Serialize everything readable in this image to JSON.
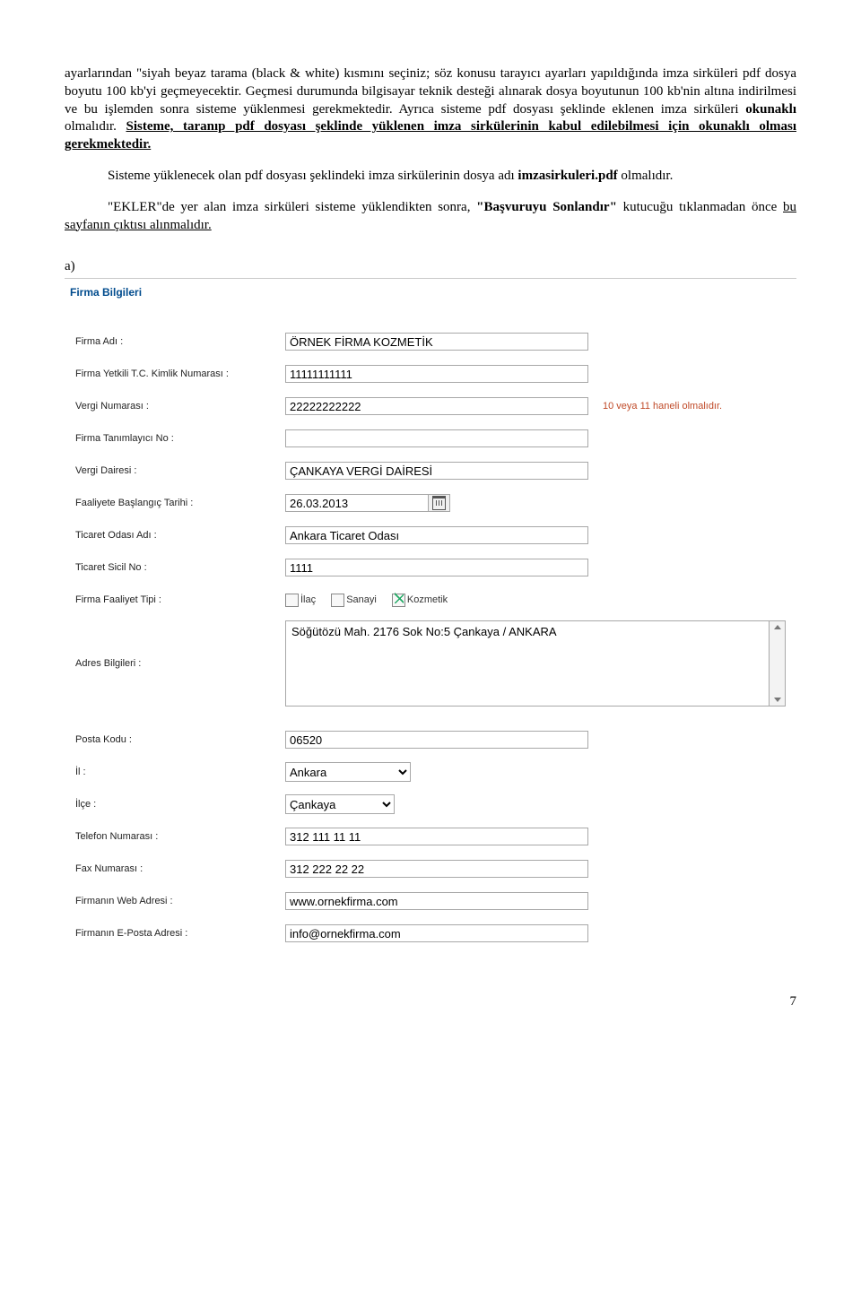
{
  "text": {
    "p1a": "ayarlarından \"siyah beyaz tarama (black & white) kısmını seçiniz; söz konusu tarayıcı ayarları yapıldığında imza sirküleri pdf dosya boyutu 100 kb'yi geçmeyecektir. Geçmesi durumunda bilgisayar teknik desteği alınarak dosya boyutunun 100 kb'nin altına indirilmesi ve bu işlemden sonra sisteme yüklenmesi gerekmektedir. Ayrıca sisteme pdf dosyası şeklinde eklenen imza sirküleri ",
    "p1_bold1": "okunaklı",
    "p1b": " olmalıdır. ",
    "p1_u": "Sisteme, taranıp pdf dosyası şeklinde yüklenen imza sirkülerinin kabul edilebilmesi için okunaklı olması gerekmektedir.",
    "p2a": "Sisteme yüklenecek olan pdf dosyası şeklindeki imza sirkülerinin dosya adı ",
    "p2_bold": "imzasirkuleri.pdf",
    "p2b": " olmalıdır.",
    "p3a": "\"EKLER\"de yer alan imza sirküleri sisteme yüklendikten sonra, ",
    "p3_bold": "\"Başvuruyu Sonlandır\"",
    "p3b": " kutucuğu tıklanmadan önce ",
    "p3_u": "bu sayfanın çıktısı alınmalıdır.",
    "a_label": "a)"
  },
  "panel": {
    "title": "Firma Bilgileri",
    "labels": {
      "firma_adi": "Firma Adı :",
      "tc": "Firma Yetkili T.C. Kimlik Numarası :",
      "vergi_no": "Vergi Numarası :",
      "tanimlayici": "Firma Tanımlayıcı No :",
      "vergi_dairesi": "Vergi Dairesi :",
      "baslangic": "Faaliyete Başlangıç Tarihi :",
      "ticaret_odasi": "Ticaret Odası Adı :",
      "sicil": "Ticaret Sicil No :",
      "faaliyet_tipi": "Firma Faaliyet Tipi :",
      "adres": "Adres Bilgileri :",
      "posta": "Posta Kodu :",
      "il": "İl :",
      "ilce": "İlçe :",
      "tel": "Telefon Numarası :",
      "fax": "Fax Numarası :",
      "web": "Firmanın Web Adresi :",
      "email": "Firmanın E-Posta Adresi :"
    },
    "values": {
      "firma_adi": "ÖRNEK FİRMA KOZMETİK",
      "tc": "11111111111",
      "vergi_no": "22222222222",
      "tanimlayici": "",
      "vergi_dairesi": "ÇANKAYA VERGİ DAİRESİ",
      "baslangic": "26.03.2013",
      "ticaret_odasi": "Ankara Ticaret Odası",
      "sicil": "1111",
      "adres": "Söğütözü Mah. 2176 Sok No:5 Çankaya / ANKARA",
      "posta": "06520",
      "il": "Ankara",
      "ilce": "Çankaya",
      "tel": "312 111 11 11",
      "fax": "312 222 22 22",
      "web": "www.ornekfirma.com",
      "email": "info@ornekfirma.com"
    },
    "hints": {
      "vergi_no": "10 veya 11 haneli olmalıdır."
    },
    "checkboxes": {
      "ilac": "İlaç",
      "sanayi": "Sanayi",
      "kozmetik": "Kozmetik"
    }
  },
  "page_number": "7"
}
